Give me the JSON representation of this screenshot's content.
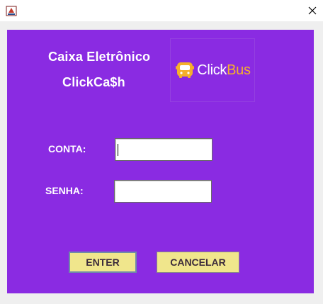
{
  "window": {
    "close_glyph": "close-icon",
    "app_icon": "java-app-icon"
  },
  "header": {
    "title_line1": "Caixa Eletrônico",
    "title_line2": "ClickCa$h"
  },
  "logo": {
    "icon": "bus-icon",
    "text_click": "Click",
    "text_bus": "Bus",
    "colors": {
      "click": "#ffffff",
      "bus": "#f5b02a"
    }
  },
  "form": {
    "conta_label": "CONTA:",
    "conta_value": "",
    "senha_label": "SENHA:",
    "senha_value": ""
  },
  "buttons": {
    "enter_label": "ENTER",
    "cancel_label": "CANCELAR"
  },
  "colors": {
    "panel_background": "#8a2be2",
    "button_background": "#f0e68c"
  }
}
